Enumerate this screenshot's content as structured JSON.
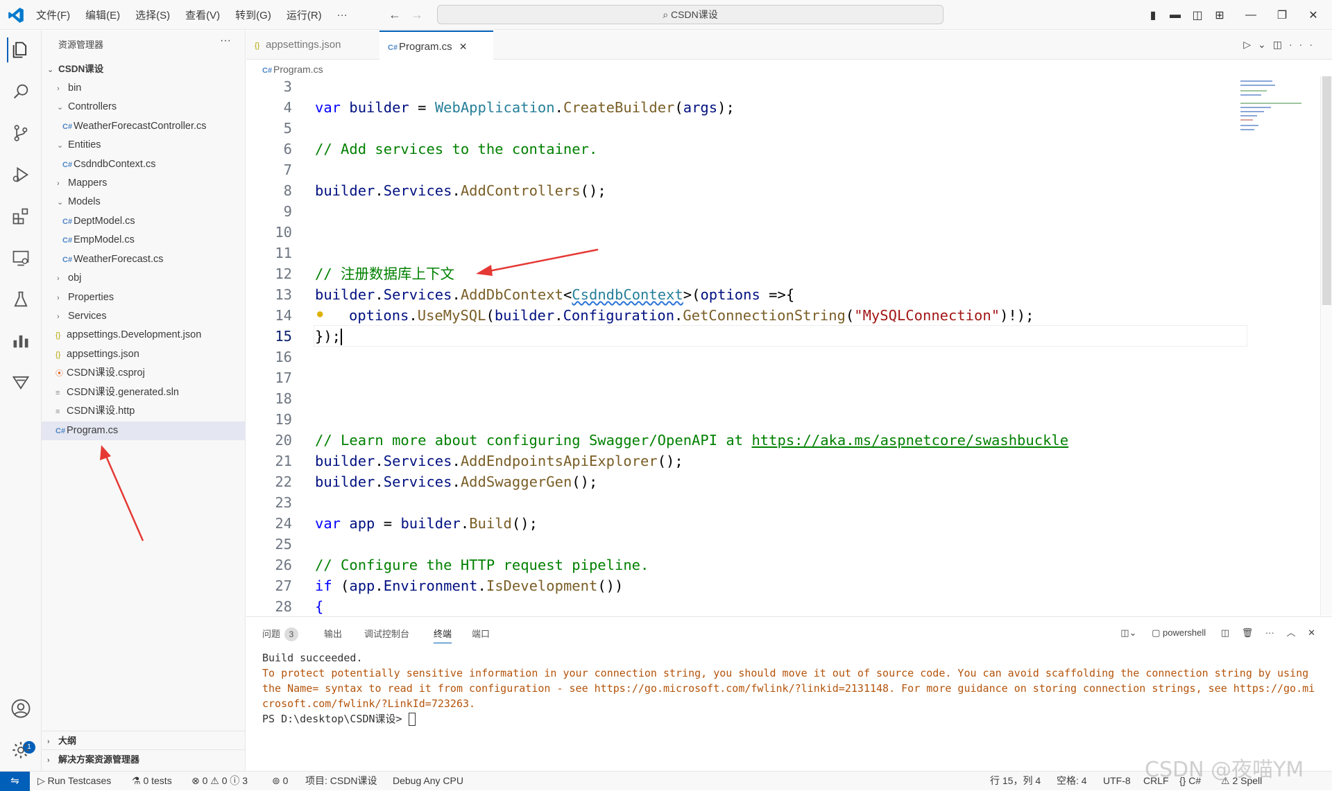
{
  "menu": [
    "文件(F)",
    "编辑(E)",
    "选择(S)",
    "查看(V)",
    "转到(G)",
    "运行(R)",
    "···"
  ],
  "command_center": "CSDN课设",
  "explorer": {
    "title": "资源管理器",
    "root": "CSDN课设",
    "items": [
      "bin",
      "Controllers",
      "WeatherForecastController.cs",
      "Entities",
      "CsdndbContext.cs",
      "Mappers",
      "Models",
      "DeptModel.cs",
      "EmpModel.cs",
      "WeatherForecast.cs",
      "obj",
      "Properties",
      "Services",
      "appsettings.Development.json",
      "appsettings.json",
      "CSDN课设.csproj",
      "CSDN课设.generated.sln",
      "CSDN课设.http",
      "Program.cs"
    ],
    "outline": "大纲",
    "solution": "解决方案资源管理器"
  },
  "tabs": {
    "t1": "appsettings.json",
    "t2": "Program.cs"
  },
  "breadcrumb": "Program.cs",
  "code_lines": {
    "n3": "3",
    "n4": "4",
    "n5": "5",
    "n6": "6",
    "n7": "7",
    "n8": "8",
    "n9": "9",
    "n10": "10",
    "n11": "11",
    "n12": "12",
    "n13": "13",
    "n14": "14",
    "n15": "15",
    "n16": "16",
    "n17": "17",
    "n18": "18",
    "n19": "19",
    "n20": "20",
    "n21": "21",
    "n22": "22",
    "n23": "23",
    "n24": "24",
    "n25": "25",
    "n26": "26",
    "n27": "27",
    "n28": "28"
  },
  "code": {
    "l6": "// Add services to the container.",
    "l12": "// 注册数据库上下文",
    "l20a": "// Learn more about configuring Swagger/OpenAPI at ",
    "l20b": "https://aka.ms/aspnetcore/swashbuckle",
    "l26": "// Configure the HTTP request pipeline.",
    "str": "\"MySQLConnection\""
  },
  "panel": {
    "problems": "问题",
    "problems_count": "3",
    "output": "输出",
    "debug_console": "调试控制台",
    "terminal": "终端",
    "ports": "端口",
    "shell": "powershell",
    "l1": "Build succeeded.",
    "l2": "To protect potentially sensitive information in your connection string, you should move it out of source code. You can avoid scaffolding the connection string by using the Name= syntax to read it from configuration - see https://go.microsoft.com/fwlink/?linkid=2131148. For more guidance on storing connection strings, see https://go.microsoft.com/fwlink/?LinkId=723263.",
    "l3": "PS D:\\desktop\\CSDN课设> "
  },
  "status": {
    "run": "Run Testcases",
    "tests": "0 tests",
    "problems": "⊗ 0 ⚠ 0 ⓘ 3",
    "ports": "0",
    "project": "项目: CSDN课设",
    "config": "Debug Any CPU",
    "position": "行 15，列 4",
    "spaces": "空格: 4",
    "encoding": "UTF-8",
    "eol": "CRLF",
    "lang": "{} C#",
    "spell": "2 Spell"
  },
  "watermark": "CSDN @夜喵YM",
  "colors": {
    "accent": "#005fb8",
    "comment": "#008000",
    "keyword": "#0000ff",
    "type": "#267f99",
    "function": "#795e26",
    "arrow": "#e53935"
  }
}
